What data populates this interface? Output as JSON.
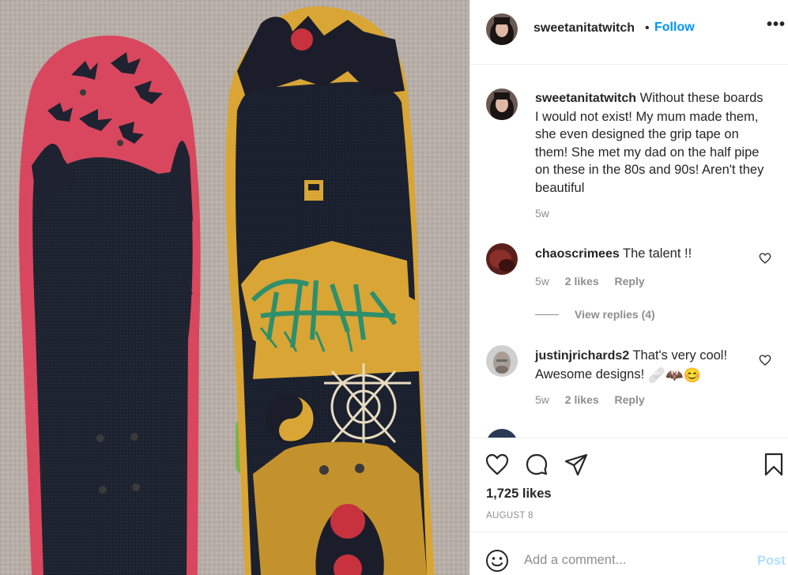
{
  "post": {
    "author": "sweetanitatwitch",
    "follow_label": "Follow",
    "dot": "•",
    "more_label": "•••"
  },
  "caption": {
    "username": "sweetanitatwitch",
    "text": "Without these boards I would not exist! My mum made them, she even designed the grip tape on them! She met my dad on the half pipe on these in the 80s and 90s! Aren't they beautiful",
    "time": "5w"
  },
  "comments": [
    {
      "username": "chaoscrimees",
      "text": "The talent !!",
      "time": "5w",
      "likes": "2 likes",
      "reply_label": "Reply",
      "view_replies": "View replies (4)"
    },
    {
      "username": "justinjrichards2",
      "text": "That's very cool! Awesome designs!",
      "emojis": "🩹🦇😊",
      "time": "5w",
      "likes": "2 likes",
      "reply_label": "Reply"
    }
  ],
  "actions": {
    "likes_count": "1,725 likes",
    "date": "AUGUST 8"
  },
  "add_comment": {
    "placeholder": "Add a comment...",
    "post_label": "Post"
  },
  "icons": {
    "like": "heart-icon",
    "comment": "comment-icon",
    "share": "share-icon",
    "save": "bookmark-icon",
    "emoji": "emoji-icon",
    "more": "more-options-icon"
  },
  "colors": {
    "follow_blue": "#0095f6",
    "post_disabled": "#b2dffc",
    "muted": "#8e8e8e",
    "text": "#262626"
  }
}
